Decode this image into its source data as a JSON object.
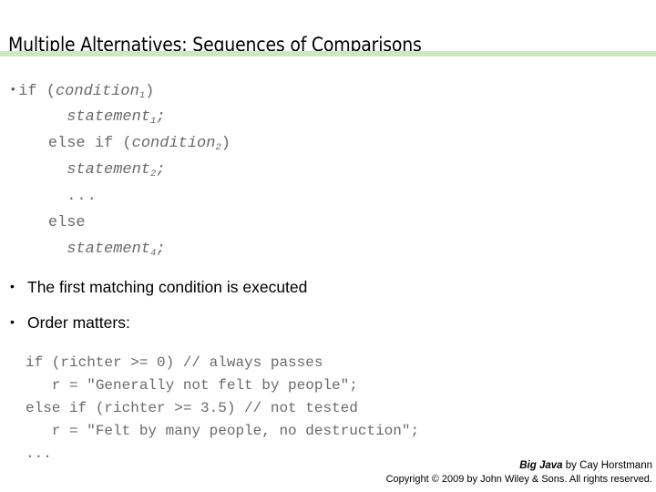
{
  "slide": {
    "title": "Multiple Alternatives: Sequences of Comparisons",
    "rule_color": "#cee7bc",
    "background_color": "#ffffff"
  },
  "pseudocode": {
    "bullet_marker": "•",
    "text_color": "#6a6a6a",
    "lines": [
      {
        "indent": "",
        "bullet": true,
        "segments": [
          {
            "text": "if (",
            "style": "plain"
          },
          {
            "text": "condition",
            "style": "italic",
            "sub": "1"
          },
          {
            "text": ")",
            "style": "plain"
          }
        ]
      },
      {
        "indent": "    ",
        "bullet": false,
        "segments": [
          {
            "text": "statement",
            "style": "italic",
            "sub": "1"
          },
          {
            "text": ";",
            "style": "italic"
          }
        ]
      },
      {
        "indent": "  ",
        "bullet": false,
        "segments": [
          {
            "text": "else if (",
            "style": "plain"
          },
          {
            "text": "condition",
            "style": "italic",
            "sub": "2"
          },
          {
            "text": ")",
            "style": "plain"
          }
        ]
      },
      {
        "indent": "    ",
        "bullet": false,
        "segments": [
          {
            "text": "statement",
            "style": "italic",
            "sub": "2"
          },
          {
            "text": ";",
            "style": "italic"
          }
        ]
      },
      {
        "indent": "    ",
        "bullet": false,
        "segments": [
          {
            "text": "...",
            "style": "dots"
          }
        ]
      },
      {
        "indent": "  ",
        "bullet": false,
        "segments": [
          {
            "text": "else",
            "style": "plain"
          }
        ]
      },
      {
        "indent": "    ",
        "bullet": false,
        "segments": [
          {
            "text": "statement",
            "style": "italic",
            "sub": "4"
          },
          {
            "text": ";",
            "style": "italic"
          }
        ]
      }
    ]
  },
  "bullets": {
    "marker": "•",
    "matching": "The first matching condition is executed",
    "order": "Order matters:"
  },
  "code_example": {
    "text_color": "#6a6a6a",
    "lines": [
      "if (richter >= 0) // always passes",
      "   r = \"Generally not felt by people\";",
      "else if (richter >= 3.5) // not tested",
      "   r = \"Felt by many people, no destruction\";",
      "..."
    ]
  },
  "footer": {
    "book_title": "Big Java",
    "attribution_rest": " by Cay Horstmann",
    "copyright": "Copyright © 2009 by John Wiley & Sons.  All rights reserved."
  }
}
